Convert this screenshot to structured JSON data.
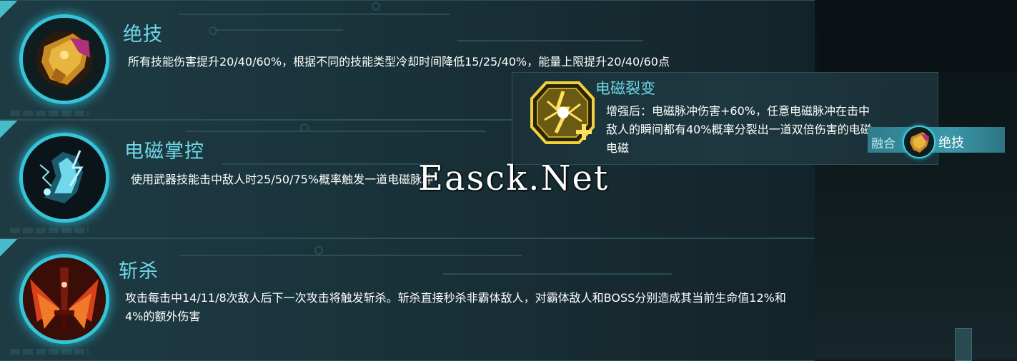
{
  "skills": [
    {
      "title": "绝技",
      "icon": "golden-gauntlet-icon",
      "description_lines": [
        "所有技能伤害提升20/40/60%，根据不同的技能类型冷却时间降低15/25/40%，能量上限提升20/40/60点"
      ]
    },
    {
      "title": "电磁掌控",
      "icon": "electric-hand-icon",
      "description_lines": [
        "使用武器技能击中敌人时25/50/75%概率触发一道电磁脉冲"
      ]
    },
    {
      "title": "斩杀",
      "icon": "flaming-sword-icon",
      "description_lines": [
        "攻击每击中14/11/8次敌人后下一次攻击将触发斩杀。斩杀直接秒杀非霸体敌人，对霸体敌人和BOSS分别造成其当前生命值12%和",
        "4%的额外伤害"
      ]
    }
  ],
  "fusion": {
    "title": "电磁裂变",
    "icon": "electric-burst-plus-icon",
    "description_lines": [
      "增强后：电磁脉冲伤害+60%，任意电磁脉冲在击中",
      "敌人的瞬间都有40%概率分裂出一道双倍伤害的电磁",
      "电磁"
    ],
    "tag_label": "融合",
    "tag_icon": "golden-gauntlet-icon",
    "tag_name": "绝技"
  },
  "watermark": "Easck.Net",
  "colors": {
    "accent_cyan": "#6fd8e8",
    "ring_cyan": "#35c4d8",
    "panel_bg": "#1e3b44",
    "fusion_tag": "#3a97a8"
  }
}
